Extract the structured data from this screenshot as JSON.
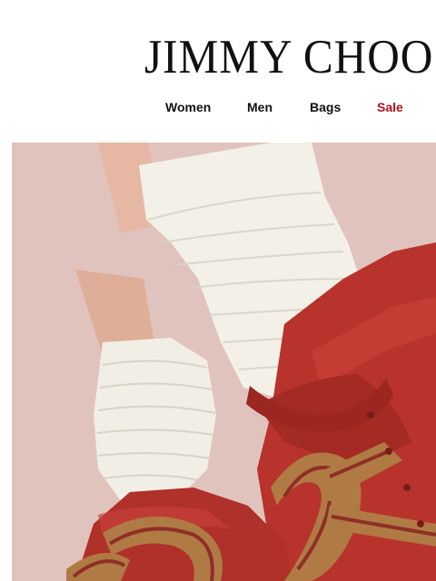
{
  "brand": {
    "logo_text": "JIMMY CHOO"
  },
  "nav": {
    "items": [
      {
        "label": "Women"
      },
      {
        "label": "Men"
      },
      {
        "label": "Bags"
      },
      {
        "label": "Sale"
      }
    ],
    "sale_color": "#b3101e"
  },
  "hero": {
    "image": "red-leather-boots-with-white-knit-socks",
    "colors": {
      "wall": "#e2c6c1",
      "boot": "#b8332c",
      "sock": "#f2efe6",
      "lace": "#b07a45",
      "lace_stripe": "#8e2f26"
    }
  }
}
